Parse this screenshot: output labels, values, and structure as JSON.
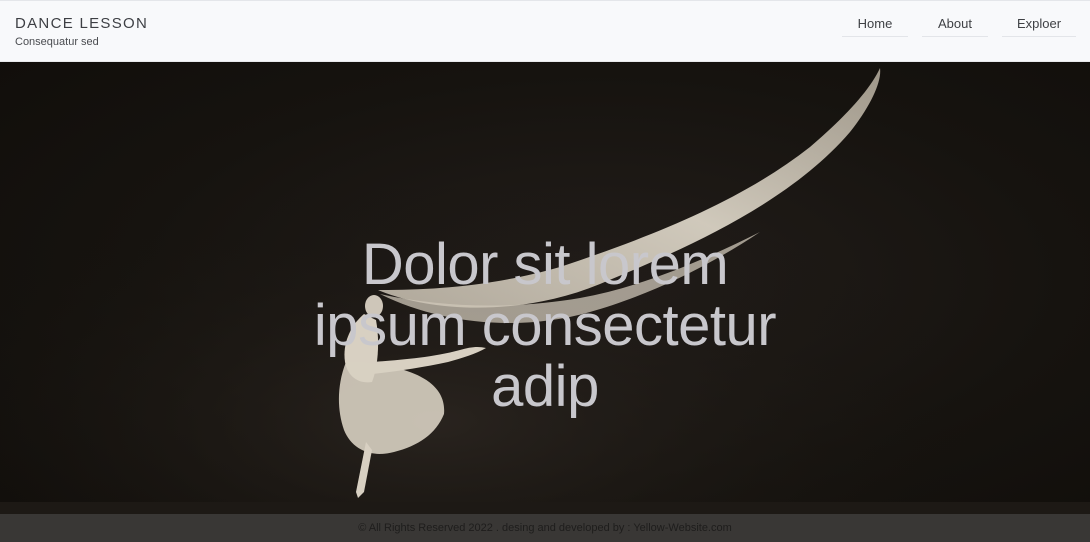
{
  "header": {
    "brand_title": "DANCE LESSON",
    "brand_subtitle": "Consequatur sed",
    "nav": [
      {
        "label": "Home"
      },
      {
        "label": "About"
      },
      {
        "label": "Exploer"
      }
    ]
  },
  "hero": {
    "heading_lines": [
      "Dolor sit lorem",
      "ipsum consectetur",
      "adip"
    ],
    "image_subject": "ballet-dancer-with-flowing-fabric"
  },
  "footer": {
    "text": "© All Rights Reserved 2022 . desing and developed by : Yellow-Website.com"
  },
  "colors": {
    "header_bg": "#f8f9fb",
    "hero_bg": "#16130f",
    "heading_text": "#c8c7cc",
    "footer_bg": "#3c3a38"
  }
}
